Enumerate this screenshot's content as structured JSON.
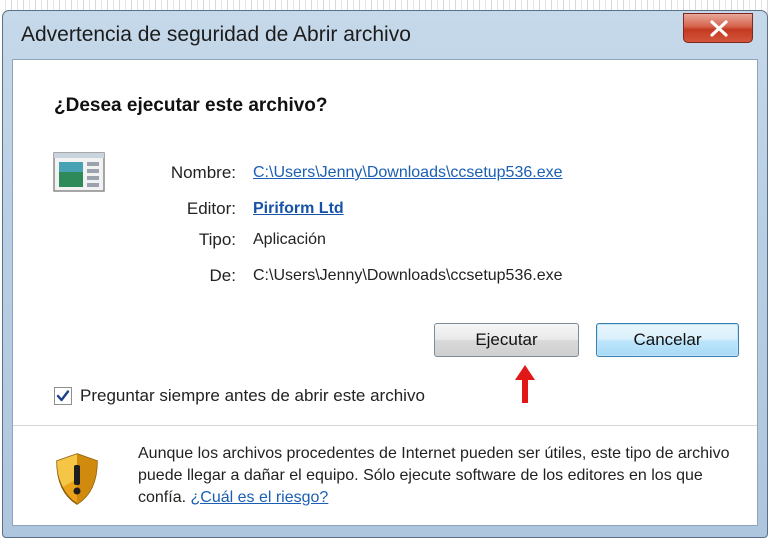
{
  "window": {
    "title": "Advertencia de seguridad de Abrir archivo",
    "close_glyph": "X"
  },
  "dialog": {
    "heading": "¿Desea ejecutar este archivo?",
    "file_icon": "application-file-icon",
    "rows": [
      {
        "label": "Nombre:",
        "value": "C:\\Users\\Jenny\\Downloads\\ccsetup536.exe"
      },
      {
        "label": "Editor:",
        "value": "Piriform Ltd"
      },
      {
        "label": "Tipo:",
        "value": "Aplicación"
      },
      {
        "label": "De:",
        "value": "C:\\Users\\Jenny\\Downloads\\ccsetup536.exe"
      }
    ],
    "run_button": "Ejecutar",
    "cancel_button": "Cancelar",
    "arrow_color": "#e01818",
    "checkbox": {
      "checked": true,
      "label": "Preguntar siempre antes de abrir este archivo"
    },
    "warning": {
      "icon": "security-shield-icon",
      "text": "Aunque los archivos procedentes de Internet pueden ser útiles, este tipo de archivo puede llegar a dañar el equipo. Sólo ejecute software de los editores en los que confía.",
      "link": "¿Cuál es el riesgo?"
    }
  },
  "colors": {
    "link": "#1a5fb4",
    "close_button": "#c43a22"
  }
}
